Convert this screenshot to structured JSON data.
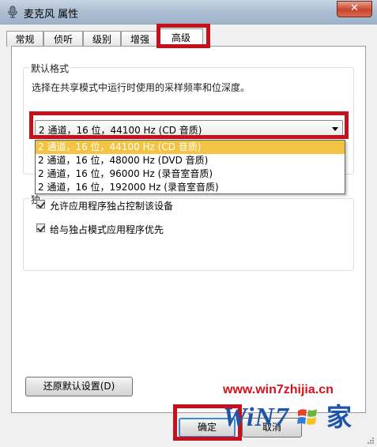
{
  "window": {
    "title": "麦克风 属性",
    "close_glyph": "✕"
  },
  "tabs": [
    {
      "label": "常规"
    },
    {
      "label": "侦听"
    },
    {
      "label": "级别"
    },
    {
      "label": "增强"
    },
    {
      "label": "高级",
      "active": true
    }
  ],
  "default_format": {
    "group_label": "默认格式",
    "description": "选择在共享模式中运行时使用的采样频率和位深度。",
    "selected_value": "2 通道，16 位，44100 Hz (CD 音质)",
    "options": [
      "2 通道，16 位，44100 Hz (CD 音质)",
      "2 通道，16 位，48000 Hz (DVD 音质)",
      "2 通道，16 位，96000 Hz (录音室音质)",
      "2 通道，16 位，192000 Hz (录音室音质)"
    ]
  },
  "exclusive_mode": {
    "group_label_partial": "独",
    "allow_exclusive_label": "允许应用程序独占控制该设备",
    "allow_exclusive_checked": true,
    "priority_label": "给与独占模式应用程序优先",
    "priority_checked": true
  },
  "buttons": {
    "restore_defaults": "还原默认设置(D)",
    "ok": "确定",
    "cancel": "取消"
  },
  "watermark": {
    "url": "www.win7zhijia.cn",
    "logo_text": "WiN7",
    "logo_suffix": "家"
  },
  "colors": {
    "highlight_box": "#c4121c",
    "selected_option": "#f3c441",
    "watermark_url": "#d5121b",
    "watermark_logo": "#1d55a8"
  }
}
